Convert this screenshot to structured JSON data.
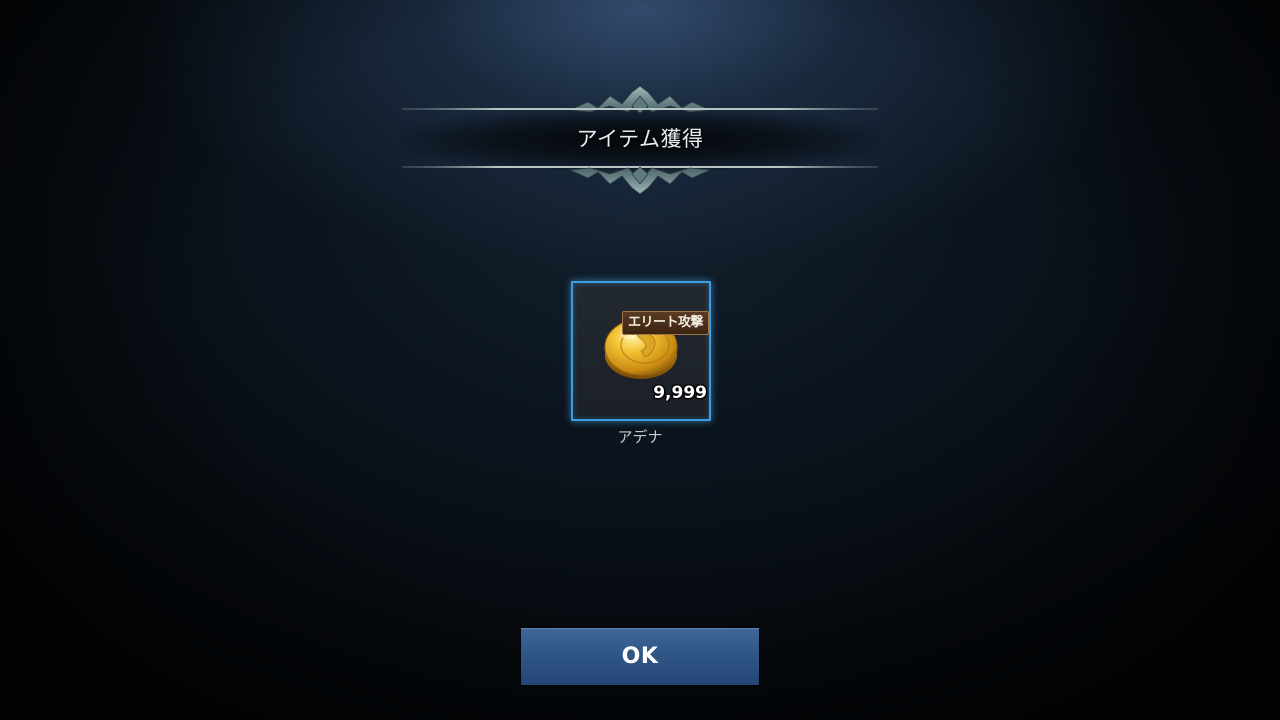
{
  "dialog": {
    "title": "アイテム獲得"
  },
  "reward_item": {
    "name": "アデナ",
    "quantity": "9,999",
    "tag": "エリート攻撃",
    "icon": "gold-coin-icon"
  },
  "buttons": {
    "ok_label": "OK"
  },
  "colors": {
    "slot_border": "#3d9ce0",
    "button_top": "#3f6697",
    "button_bottom": "#234574",
    "ornament": "#6f8d92"
  }
}
